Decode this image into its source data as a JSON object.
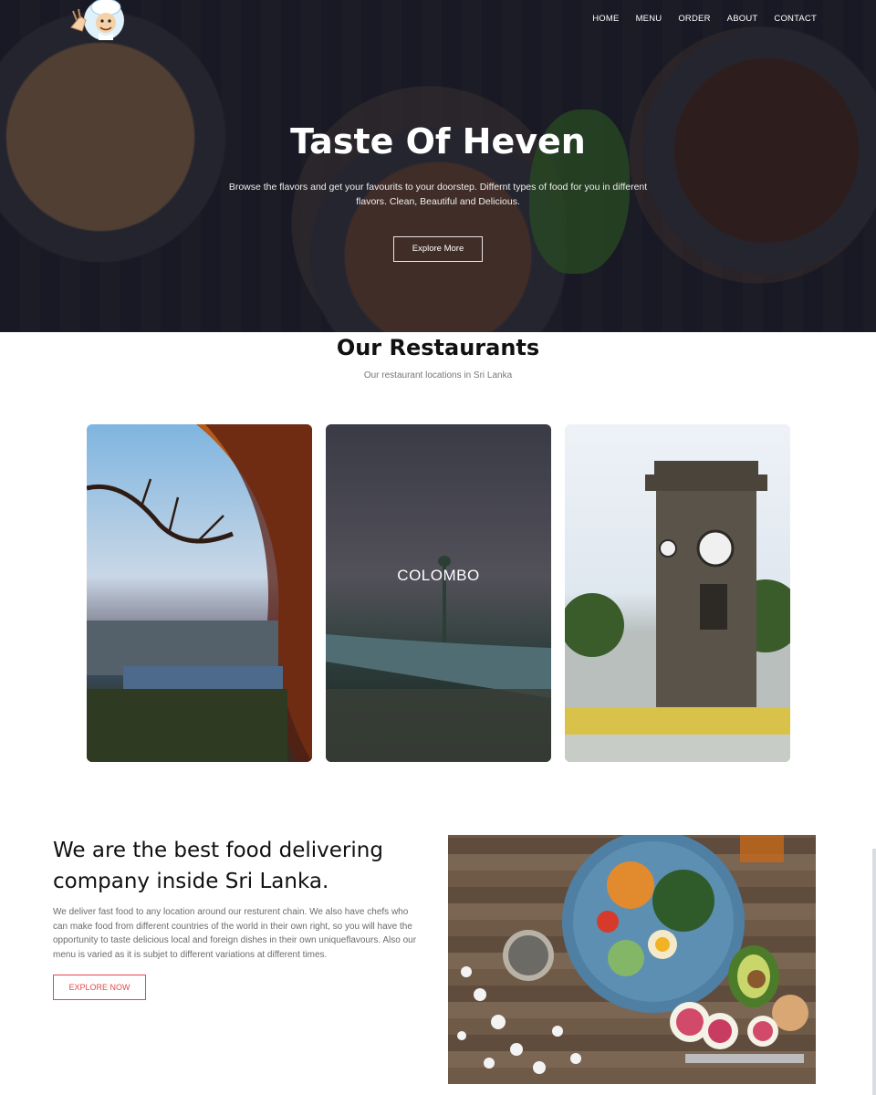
{
  "nav": {
    "items": [
      "HOME",
      "MENU",
      "ORDER",
      "ABOUT",
      "CONTACT"
    ]
  },
  "hero": {
    "title": "Taste Of Heven",
    "description": "Browse the flavors and get your favourits to your doorstep. Differnt types of food for you in different flavors. Clean, Beautiful and Delicious.",
    "button_label": "Explore More"
  },
  "restaurants": {
    "title": "Our Restaurants",
    "subtitle": "Our restaurant locations in Sri Lanka",
    "cards": [
      {
        "label": ""
      },
      {
        "label": "COLOMBO"
      },
      {
        "label": ""
      }
    ]
  },
  "about": {
    "title": "We are the best food delivering company inside Sri Lanka.",
    "description": "We deliver fast food to any location around our resturent chain. We also have chefs who can make food from different countries of the world in their own right, so you will have the opportunity to taste delicious local and foreign dishes in their own uniqueflavours. Also our menu is varied as it is subjet to different variations at different times.",
    "button_label": "EXPLORE NOW"
  },
  "colors": {
    "accent": "#e4474d",
    "hero_overlay": "#1a1a26"
  },
  "icons": [
    "chef-logo-icon"
  ]
}
